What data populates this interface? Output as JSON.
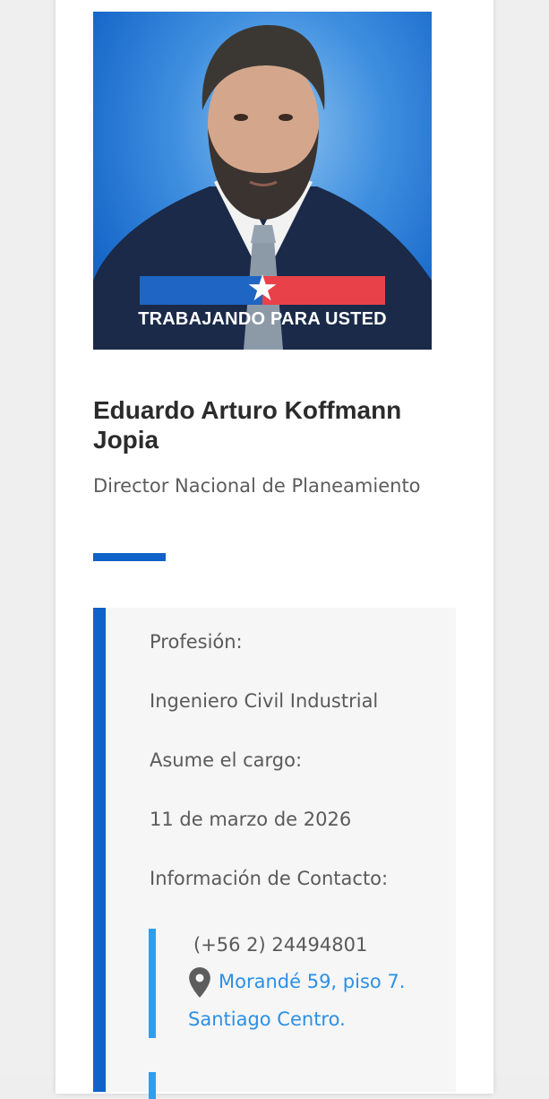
{
  "profile": {
    "photo_slogan": "TRABAJANDO PARA USTED",
    "name": "Eduardo Arturo Koffmann Jopia",
    "role": "Director Nacional de Planeamiento"
  },
  "details": {
    "profession_label": "Profesión:",
    "profession_value": "Ingeniero Civil Industrial",
    "start_label": "Asume el cargo:",
    "start_value": "11 de marzo de 2026",
    "contact_label": "Información de Contacto:"
  },
  "contact": {
    "phone": "(+56 2) 24494801",
    "address_line1": "Morandé 59, piso 7.",
    "address_line2": "Santiago Centro.",
    "address_icon": "location-pin-icon"
  },
  "colors": {
    "accent_blue": "#0f62c8",
    "light_blue": "#2d9ff0",
    "link_blue": "#2b90e6",
    "flag_red": "#e94149"
  }
}
